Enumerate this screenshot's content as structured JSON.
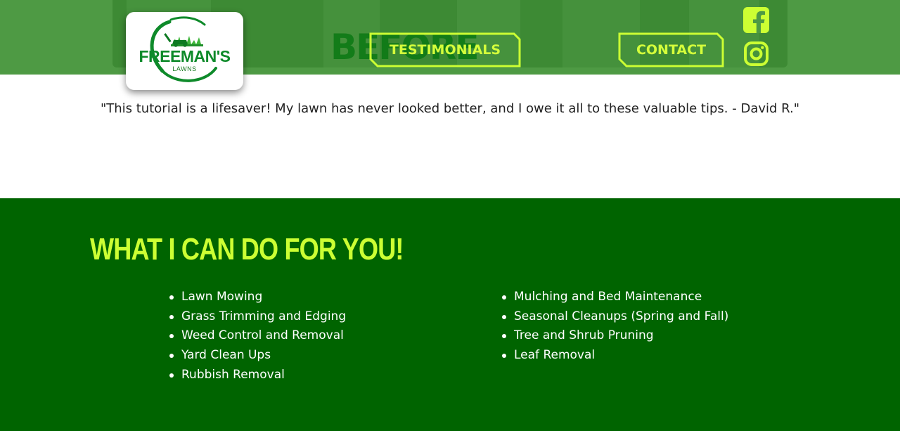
{
  "brand": {
    "name": "FREEMAN'S",
    "sub": "LAWNS"
  },
  "hero": {
    "overlay_text": "BEFORE"
  },
  "nav": {
    "testimonials_label": "TESTIMONIALS",
    "contact_label": "CONTACT"
  },
  "social": {
    "facebook_icon": "facebook-icon",
    "instagram_icon": "instagram-icon"
  },
  "testimonial": {
    "text": "\"This tutorial is a lifesaver! My lawn has never looked better, and I owe it all to these valuable tips. - David R.\""
  },
  "services": {
    "title": "WHAT I CAN DO FOR YOU!",
    "left": [
      "Lawn Mowing",
      "Grass Trimming and Edging",
      "Weed Control and Removal",
      "Yard Clean Ups",
      "Rubbish Removal"
    ],
    "right": [
      "Mulching and Bed Maintenance",
      "Seasonal Cleanups (Spring and Fall)",
      "Tree and Shrub Pruning",
      "Leaf Removal"
    ]
  },
  "colors": {
    "header_bg": "#4e9a44",
    "accent": "#ccff33",
    "services_bg": "#006400",
    "brand_green": "#0e8a2a"
  }
}
